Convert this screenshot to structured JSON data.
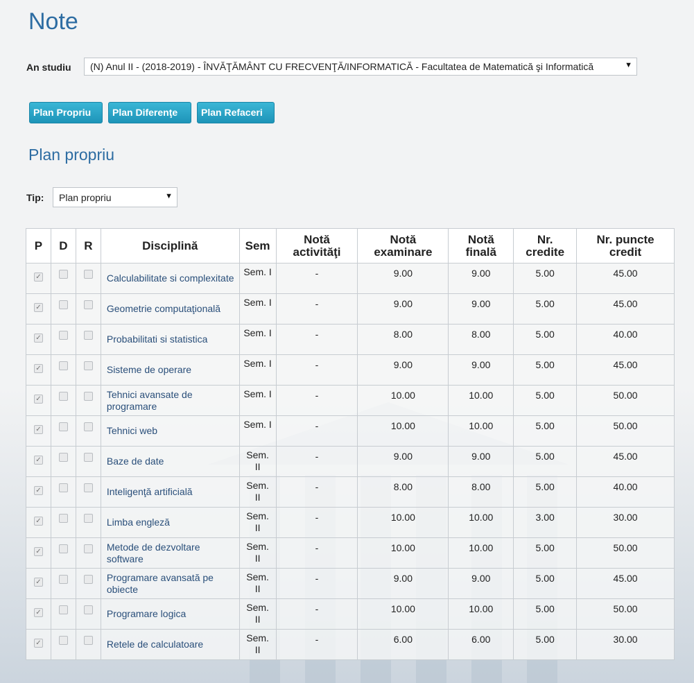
{
  "page_title": "Note",
  "an_studiu": {
    "label": "An studiu",
    "selected": "(N) Anul II - (2018-2019) - ÎNVĂŢĂMÂNT CU FRECVENŢĂ/INFORMATICĂ - Facultatea de Matematică şi Informatică"
  },
  "buttons": {
    "propriu": "Plan Propriu",
    "diferente": "Plan Diferenţe",
    "refaceri": "Plan Refaceri"
  },
  "section_title": "Plan propriu",
  "tip": {
    "label": "Tip:",
    "selected": "Plan propriu"
  },
  "table": {
    "headers": [
      "P",
      "D",
      "R",
      "Disciplină",
      "Sem",
      "Notă activităţi",
      "Notă examinare",
      "Notă finală",
      "Nr. credite",
      "Nr. puncte credit"
    ],
    "rows": [
      {
        "p": true,
        "d": false,
        "r": false,
        "disciplina": "Calculabilitate si complexitate",
        "sem": "Sem. I",
        "nota_activitati": "-",
        "nota_examinare": "9.00",
        "nota_finala": "9.00",
        "credite": "5.00",
        "puncte": "45.00"
      },
      {
        "p": true,
        "d": false,
        "r": false,
        "disciplina": "Geometrie computaţională",
        "sem": "Sem. I",
        "nota_activitati": "-",
        "nota_examinare": "9.00",
        "nota_finala": "9.00",
        "credite": "5.00",
        "puncte": "45.00"
      },
      {
        "p": true,
        "d": false,
        "r": false,
        "disciplina": "Probabilitati si statistica",
        "sem": "Sem. I",
        "nota_activitati": "-",
        "nota_examinare": "8.00",
        "nota_finala": "8.00",
        "credite": "5.00",
        "puncte": "40.00"
      },
      {
        "p": true,
        "d": false,
        "r": false,
        "disciplina": "Sisteme de operare",
        "sem": "Sem. I",
        "nota_activitati": "-",
        "nota_examinare": "9.00",
        "nota_finala": "9.00",
        "credite": "5.00",
        "puncte": "45.00"
      },
      {
        "p": true,
        "d": false,
        "r": false,
        "disciplina": "Tehnici avansate de programare",
        "sem": "Sem. I",
        "nota_activitati": "-",
        "nota_examinare": "10.00",
        "nota_finala": "10.00",
        "credite": "5.00",
        "puncte": "50.00"
      },
      {
        "p": true,
        "d": false,
        "r": false,
        "disciplina": "Tehnici web",
        "sem": "Sem. I",
        "nota_activitati": "-",
        "nota_examinare": "10.00",
        "nota_finala": "10.00",
        "credite": "5.00",
        "puncte": "50.00"
      },
      {
        "p": true,
        "d": false,
        "r": false,
        "disciplina": "Baze de date",
        "sem": "Sem. II",
        "nota_activitati": "-",
        "nota_examinare": "9.00",
        "nota_finala": "9.00",
        "credite": "5.00",
        "puncte": "45.00"
      },
      {
        "p": true,
        "d": false,
        "r": false,
        "disciplina": "Inteligenţă artificială",
        "sem": "Sem. II",
        "nota_activitati": "-",
        "nota_examinare": "8.00",
        "nota_finala": "8.00",
        "credite": "5.00",
        "puncte": "40.00"
      },
      {
        "p": true,
        "d": false,
        "r": false,
        "disciplina": "Limba engleză",
        "sem": "Sem. II",
        "nota_activitati": "-",
        "nota_examinare": "10.00",
        "nota_finala": "10.00",
        "credite": "3.00",
        "puncte": "30.00"
      },
      {
        "p": true,
        "d": false,
        "r": false,
        "disciplina": "Metode de dezvoltare software",
        "sem": "Sem. II",
        "nota_activitati": "-",
        "nota_examinare": "10.00",
        "nota_finala": "10.00",
        "credite": "5.00",
        "puncte": "50.00"
      },
      {
        "p": true,
        "d": false,
        "r": false,
        "disciplina": "Programare avansată pe obiecte",
        "sem": "Sem. II",
        "nota_activitati": "-",
        "nota_examinare": "9.00",
        "nota_finala": "9.00",
        "credite": "5.00",
        "puncte": "45.00"
      },
      {
        "p": true,
        "d": false,
        "r": false,
        "disciplina": "Programare logica",
        "sem": "Sem. II",
        "nota_activitati": "-",
        "nota_examinare": "10.00",
        "nota_finala": "10.00",
        "credite": "5.00",
        "puncte": "50.00"
      },
      {
        "p": true,
        "d": false,
        "r": false,
        "disciplina": "Retele de calculatoare",
        "sem": "Sem. II",
        "nota_activitati": "-",
        "nota_examinare": "6.00",
        "nota_finala": "6.00",
        "credite": "5.00",
        "puncte": "30.00"
      }
    ]
  }
}
